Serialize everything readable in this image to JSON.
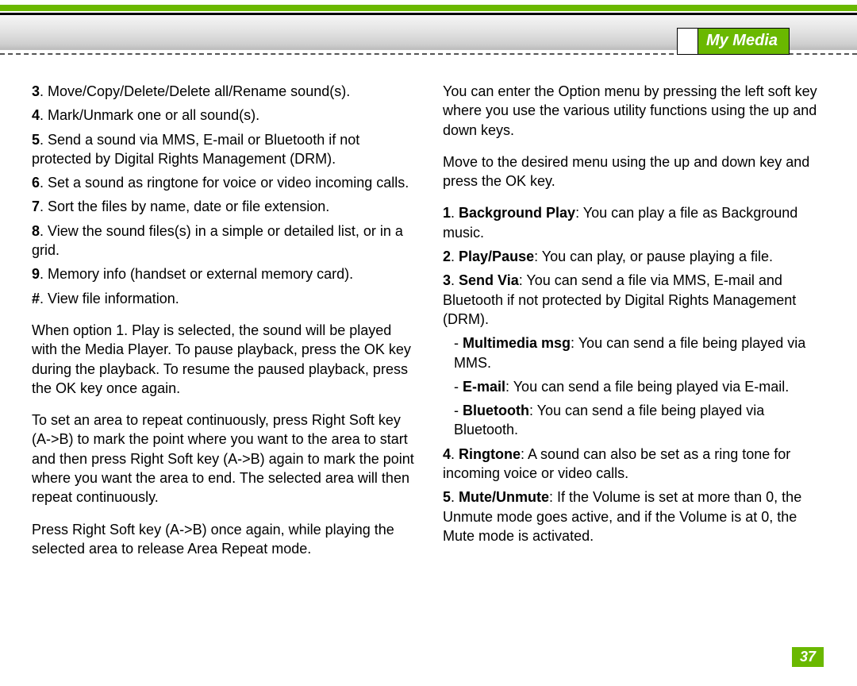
{
  "header": {
    "section_title": "My Media"
  },
  "page_number": "37",
  "left": {
    "items": [
      {
        "n": "3",
        "t": "Move/Copy/Delete/Delete all/Rename sound(s)."
      },
      {
        "n": "4",
        "t": "Mark/Unmark one or all sound(s)."
      },
      {
        "n": "5",
        "t": "Send a sound via MMS, E-mail or Bluetooth if not protected by Digital Rights Management (DRM)."
      },
      {
        "n": "6",
        "t": "Set a sound as ringtone for voice or video incoming calls."
      },
      {
        "n": "7",
        "t": "Sort the files by name, date or file extension."
      },
      {
        "n": "8",
        "t": "View the sound files(s) in a simple or detailed list, or in a grid."
      },
      {
        "n": "9",
        "t": "Memory info (handset or external memory card)."
      },
      {
        "n": "#",
        "t": "View file information."
      }
    ],
    "para1": "When option 1. Play is selected, the sound will be played with the Media Player. To pause playback, press the OK key during the playback. To resume the paused playback, press the OK key once again.",
    "para2": "To set an area to repeat continuously, press Right Soft key (A->B) to mark the point where you want to the area to start and then press Right Soft key (A->B) again to mark the point where you want the area to end. The selected area will then repeat continuously.",
    "para3": "Press Right Soft key (A->B) once again, while playing the selected area to release Area Repeat mode."
  },
  "right": {
    "para1": "You can enter the Option menu by pressing the left soft key where you use the various utility functions using the up and down keys.",
    "para2": "Move to the desired menu using the up and down key and press the OK key.",
    "items": [
      {
        "n": "1",
        "bold": "Background Play",
        "t": ": You can play a file as Background music."
      },
      {
        "n": "2",
        "bold": "Play/Pause",
        "t": ": You can play, or pause playing a file."
      },
      {
        "n": "3",
        "bold": "Send Via",
        "t": ": You can send a file via MMS, E-mail and Bluetooth if not protected by Digital Rights Management (DRM)."
      }
    ],
    "subitems": [
      {
        "bold": "Multimedia msg",
        "t": ": You can send a file being played via MMS."
      },
      {
        "bold": "E-mail",
        "t": ": You can send a file being played via E-mail."
      },
      {
        "bold": "Bluetooth",
        "t": ": You can send a file being played via Bluetooth."
      }
    ],
    "items2": [
      {
        "n": "4",
        "bold": "Ringtone",
        "t": ": A sound can also be set as a ring tone for incoming voice or video calls."
      },
      {
        "n": "5",
        "bold": "Mute/Unmute",
        "t": ": If the Volume is set at more than 0, the Unmute mode goes active, and if the Volume is at 0, the Mute mode is activated."
      }
    ]
  }
}
